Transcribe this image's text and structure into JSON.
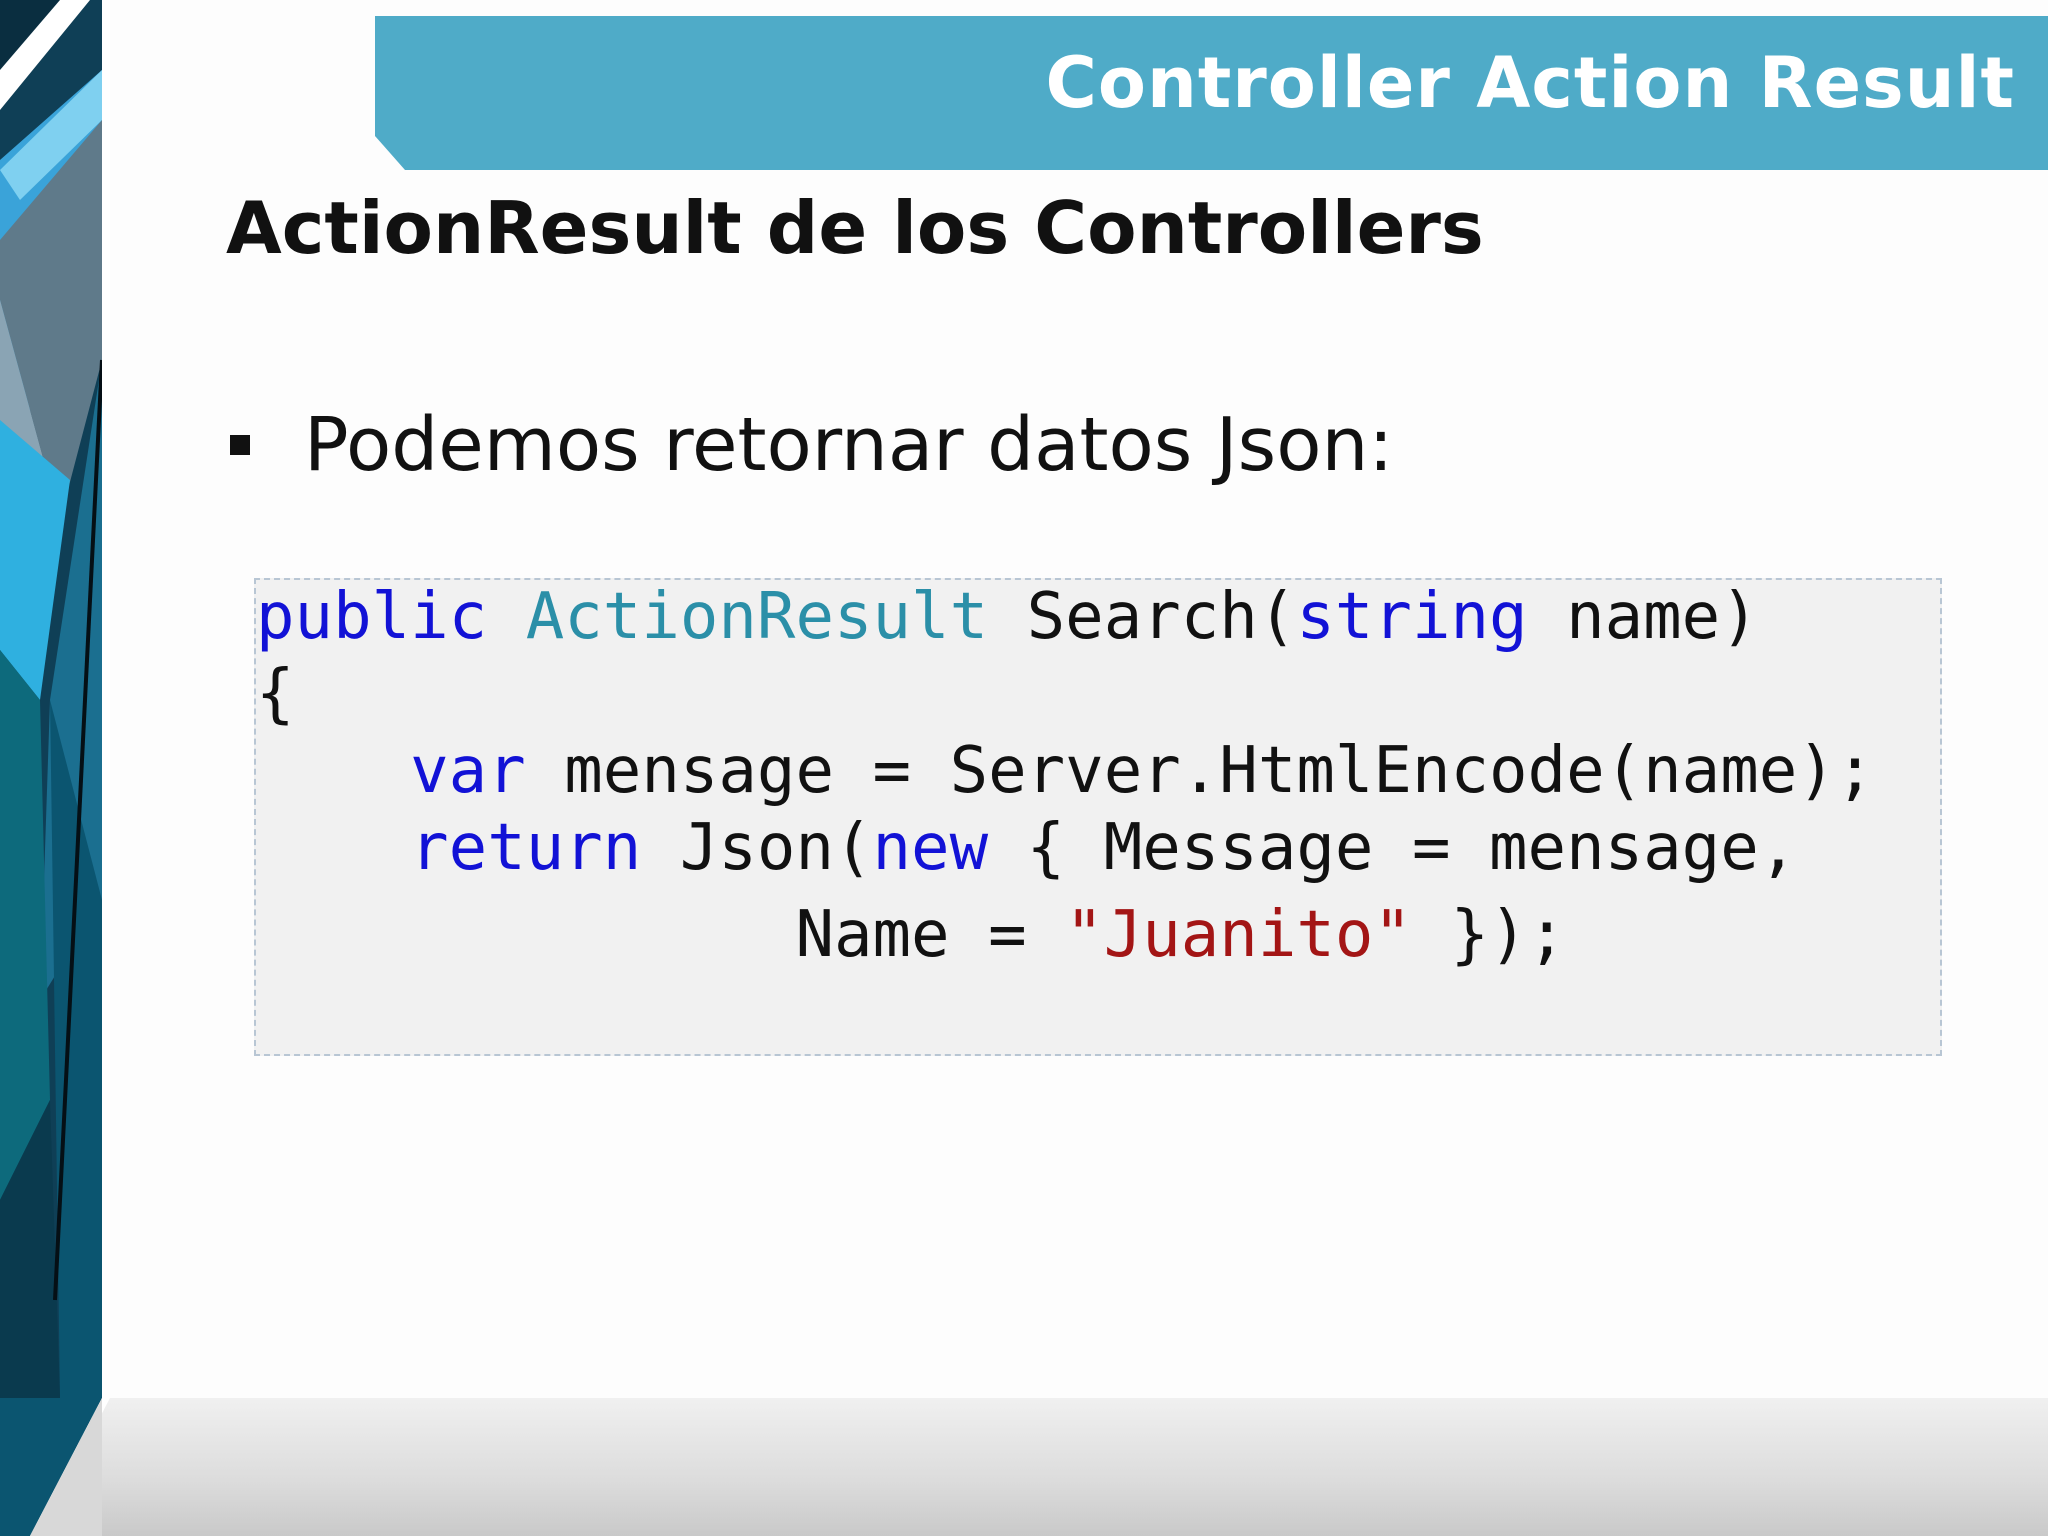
{
  "header": {
    "title": "Controller Action Result"
  },
  "subtitle": "ActionResult de los Controllers",
  "bullet": {
    "text": "Podemos retornar datos Json:"
  },
  "code": {
    "line1": {
      "kw_public": "public",
      "type_actionresult": "ActionResult",
      "method": "Search(",
      "kw_string": "string",
      "param": "name)"
    },
    "line2": {
      "brace": "{"
    },
    "line3": {
      "kw_var": "var",
      "rest": "mensage = Server.HtmlEncode(name);"
    },
    "line4": {
      "kw_return": "return",
      "json_call": "Json(",
      "kw_new": "new",
      "rest": "{ Message = mensage,"
    },
    "line5": {
      "name_assign": "Name = ",
      "string_value": "\"Juanito\"",
      "closing": "});"
    }
  },
  "colors": {
    "header_bar": "#4fabc8",
    "keyword": "#1212d6",
    "type": "#2b8fa8",
    "string": "#a31515",
    "code_background": "#f1f1f1"
  }
}
